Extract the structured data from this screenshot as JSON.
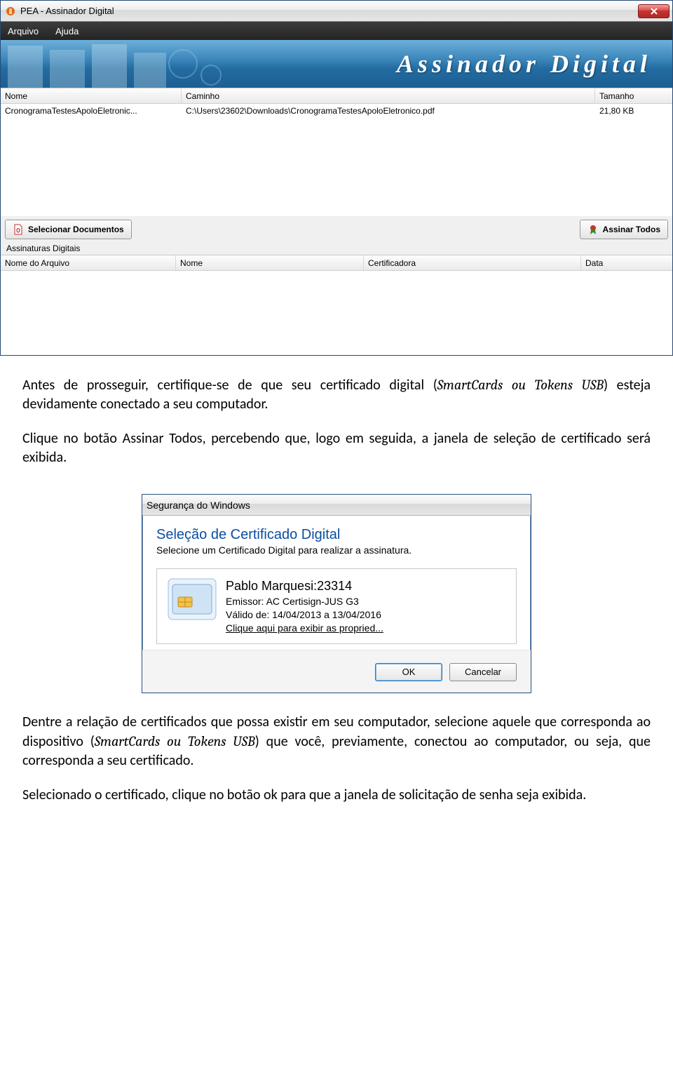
{
  "window": {
    "title": "PEA - Assinador Digital",
    "menu": {
      "arquivo": "Arquivo",
      "ajuda": "Ajuda"
    },
    "banner_title": "Assinador Digital",
    "file_cols": {
      "nome": "Nome",
      "caminho": "Caminho",
      "tamanho": "Tamanho"
    },
    "files": [
      {
        "nome": "CronogramaTestesApoloEletronic...",
        "caminho": "C:\\Users\\23602\\Downloads\\CronogramaTestesApoloEletronico.pdf",
        "tamanho": "21,80 KB"
      }
    ],
    "btn_select": "Selecionar Documentos",
    "btn_sign_all": "Assinar Todos",
    "sig_section_label": "Assinaturas Digitais",
    "sig_cols": {
      "arquivo": "Nome do Arquivo",
      "nome": "Nome",
      "cert": "Certificadora",
      "data": "Data"
    }
  },
  "text": {
    "p1_a": "Antes de prosseguir, certifique-se de que seu certificado digital (",
    "p1_em": "SmartCards ou Tokens USB",
    "p1_b": ") esteja devidamente conectado a seu computador.",
    "p2": "Clique no botão Assinar Todos, percebendo que, logo em seguida, a janela de seleção de certificado será exibida.",
    "p3_a": "Dentre a relação de certificados que possa existir em seu computador, selecione aquele que corresponda ao dispositivo (",
    "p3_em": "SmartCards ou Tokens USB",
    "p3_b": ") que você, previamente, conectou ao computador, ou seja, que corresponda a seu certificado.",
    "p4": "Selecionado o certificado, clique no botão ok para que a janela de solicitação de senha seja exibida."
  },
  "dialog": {
    "title": "Segurança do Windows",
    "heading": "Seleção de Certificado Digital",
    "subtitle": "Selecione um Certificado Digital para realizar a assinatura.",
    "cert": {
      "name": "Pablo Marquesi:23314",
      "issuer": "Emissor: AC Certisign-JUS G3",
      "valid": "Válido de: 14/04/2013 a 13/04/2016",
      "link": "Clique aqui para exibir as propried..."
    },
    "ok": "OK",
    "cancel": "Cancelar"
  }
}
